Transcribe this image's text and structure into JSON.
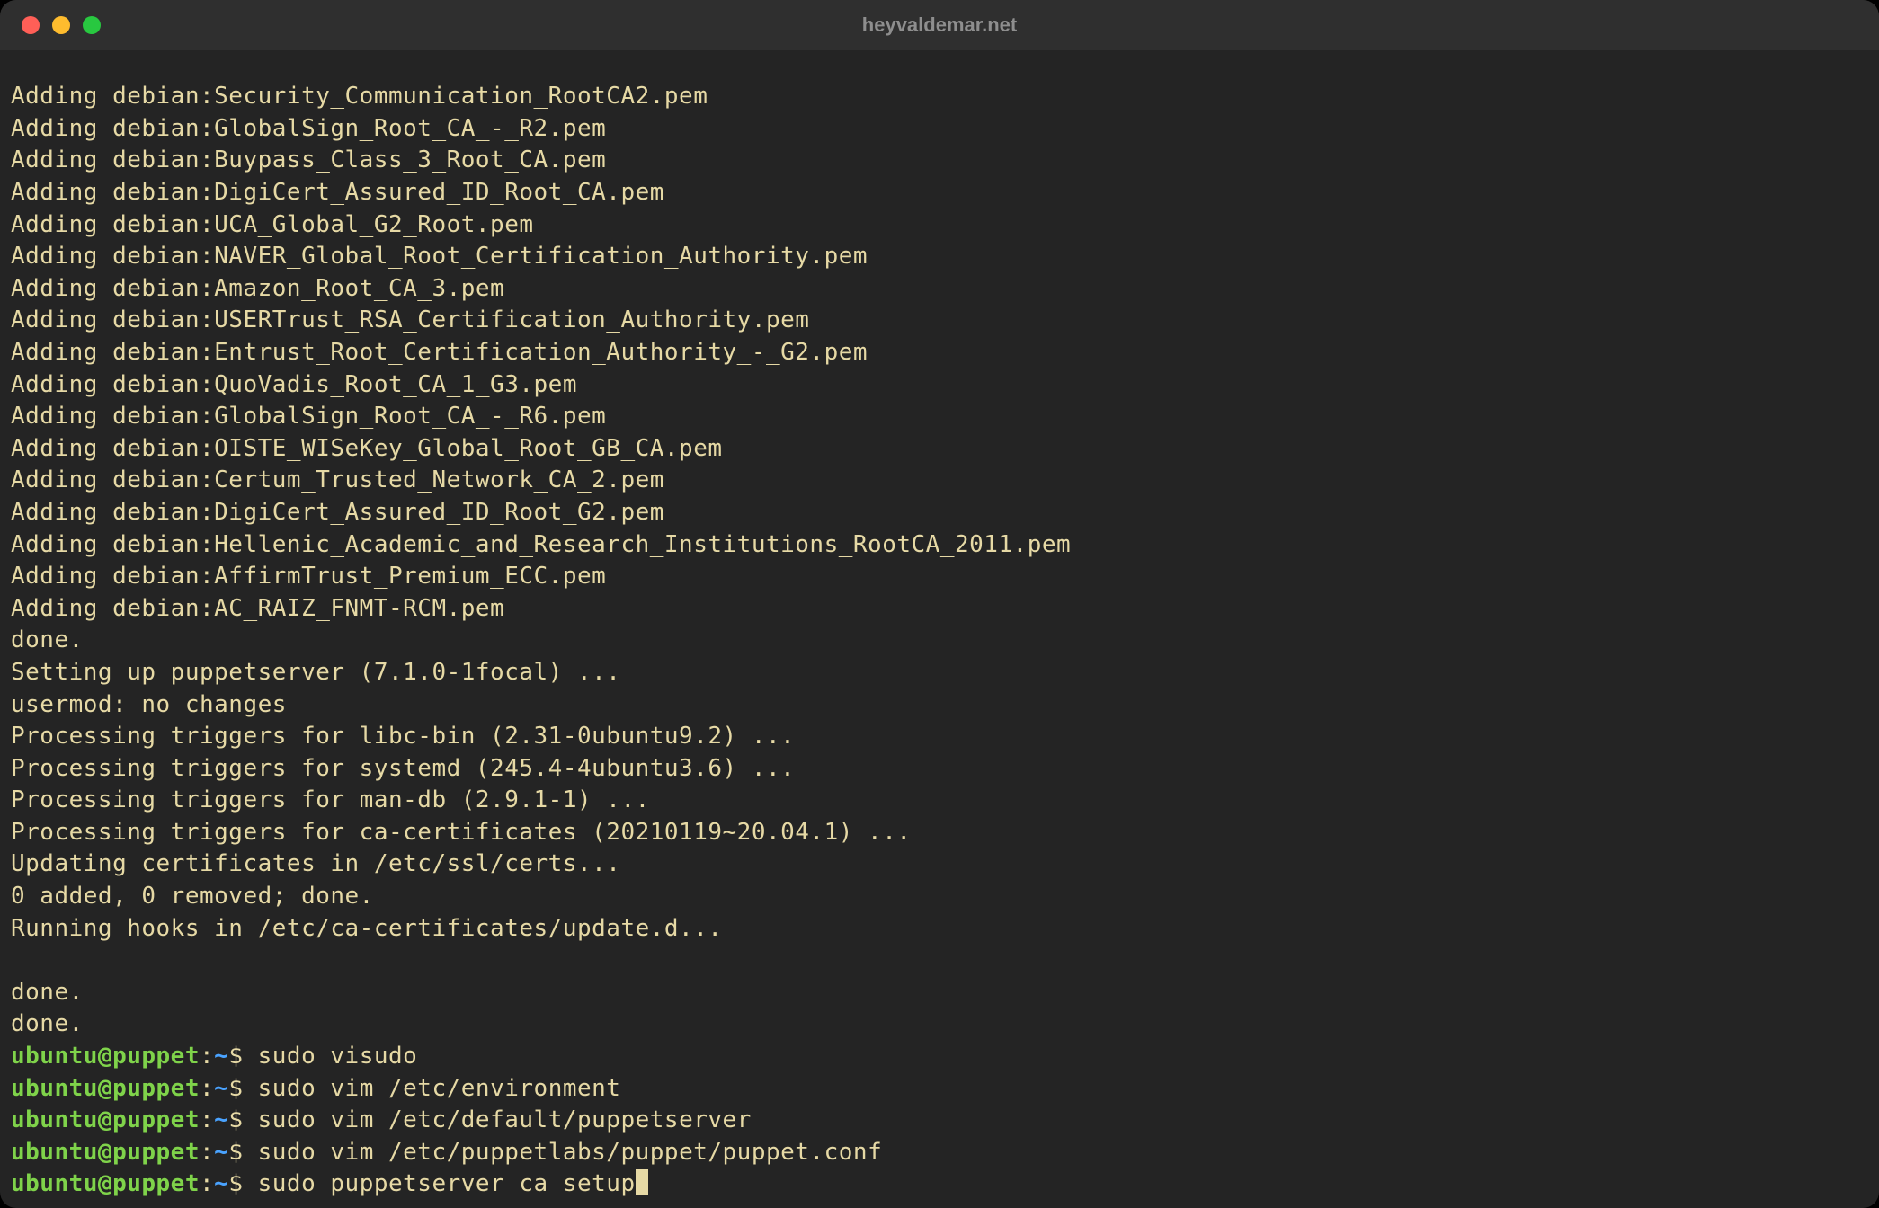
{
  "window": {
    "title": "heyvaldemar.net"
  },
  "colors": {
    "background": "#242424",
    "titlebar": "#2f2f2f",
    "close": "#ff5f57",
    "minimize": "#febc2e",
    "zoom": "#28c840",
    "text": "#e6d9a5",
    "prompt_user": "#7fd34a",
    "prompt_path": "#4aa3ff"
  },
  "output_lines": [
    "Adding debian:Security_Communication_RootCA2.pem",
    "Adding debian:GlobalSign_Root_CA_-_R2.pem",
    "Adding debian:Buypass_Class_3_Root_CA.pem",
    "Adding debian:DigiCert_Assured_ID_Root_CA.pem",
    "Adding debian:UCA_Global_G2_Root.pem",
    "Adding debian:NAVER_Global_Root_Certification_Authority.pem",
    "Adding debian:Amazon_Root_CA_3.pem",
    "Adding debian:USERTrust_RSA_Certification_Authority.pem",
    "Adding debian:Entrust_Root_Certification_Authority_-_G2.pem",
    "Adding debian:QuoVadis_Root_CA_1_G3.pem",
    "Adding debian:GlobalSign_Root_CA_-_R6.pem",
    "Adding debian:OISTE_WISeKey_Global_Root_GB_CA.pem",
    "Adding debian:Certum_Trusted_Network_CA_2.pem",
    "Adding debian:DigiCert_Assured_ID_Root_G2.pem",
    "Adding debian:Hellenic_Academic_and_Research_Institutions_RootCA_2011.pem",
    "Adding debian:AffirmTrust_Premium_ECC.pem",
    "Adding debian:AC_RAIZ_FNMT-RCM.pem",
    "done.",
    "Setting up puppetserver (7.1.0-1focal) ...",
    "usermod: no changes",
    "Processing triggers for libc-bin (2.31-0ubuntu9.2) ...",
    "Processing triggers for systemd (245.4-4ubuntu3.6) ...",
    "Processing triggers for man-db (2.9.1-1) ...",
    "Processing triggers for ca-certificates (20210119~20.04.1) ...",
    "Updating certificates in /etc/ssl/certs...",
    "0 added, 0 removed; done.",
    "Running hooks in /etc/ca-certificates/update.d...",
    "",
    "done.",
    "done."
  ],
  "prompt": {
    "user_host": "ubuntu@puppet",
    "colon": ":",
    "path": "~",
    "symbol": "$ "
  },
  "commands": [
    "sudo visudo",
    "sudo vim /etc/environment",
    "sudo vim /etc/default/puppetserver",
    "sudo vim /etc/puppetlabs/puppet/puppet.conf",
    "sudo puppetserver ca setup"
  ]
}
